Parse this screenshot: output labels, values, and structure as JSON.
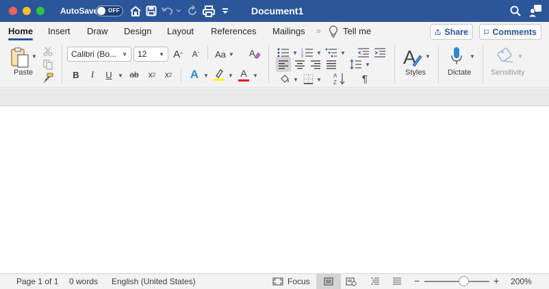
{
  "titlebar": {
    "autosave_label": "AutoSave",
    "toggle_state": "OFF",
    "document_title": "Document1",
    "bg_color": "#2b579a"
  },
  "tabs": {
    "items": [
      "Home",
      "Insert",
      "Draw",
      "Design",
      "Layout",
      "References",
      "Mailings"
    ],
    "active": "Home",
    "tell_me": "Tell me",
    "share_label": "Share",
    "comments_label": "Comments"
  },
  "ribbon": {
    "paste_label": "Paste",
    "font_name": "Calibri (Bo...",
    "font_size": "12",
    "grow_font": "A",
    "shrink_font": "A",
    "change_case": "Aa",
    "bold": "B",
    "italic": "I",
    "underline": "U",
    "strikethrough": "ab",
    "subscript": "x",
    "subscript_suffix": "2",
    "superscript": "x",
    "superscript_suffix": "2",
    "text_effects": "A",
    "font_color": "A",
    "font_color_bar": "#e81123",
    "highlight_bar": "#ffff00",
    "styles_label": "Styles",
    "dictate_label": "Dictate",
    "sensitivity_label": "Sensitivity"
  },
  "status": {
    "page": "Page 1 of 1",
    "words": "0 words",
    "language": "English (United States)",
    "focus": "Focus",
    "zoom_minus": "−",
    "zoom_plus": "+",
    "zoom": "200%"
  }
}
